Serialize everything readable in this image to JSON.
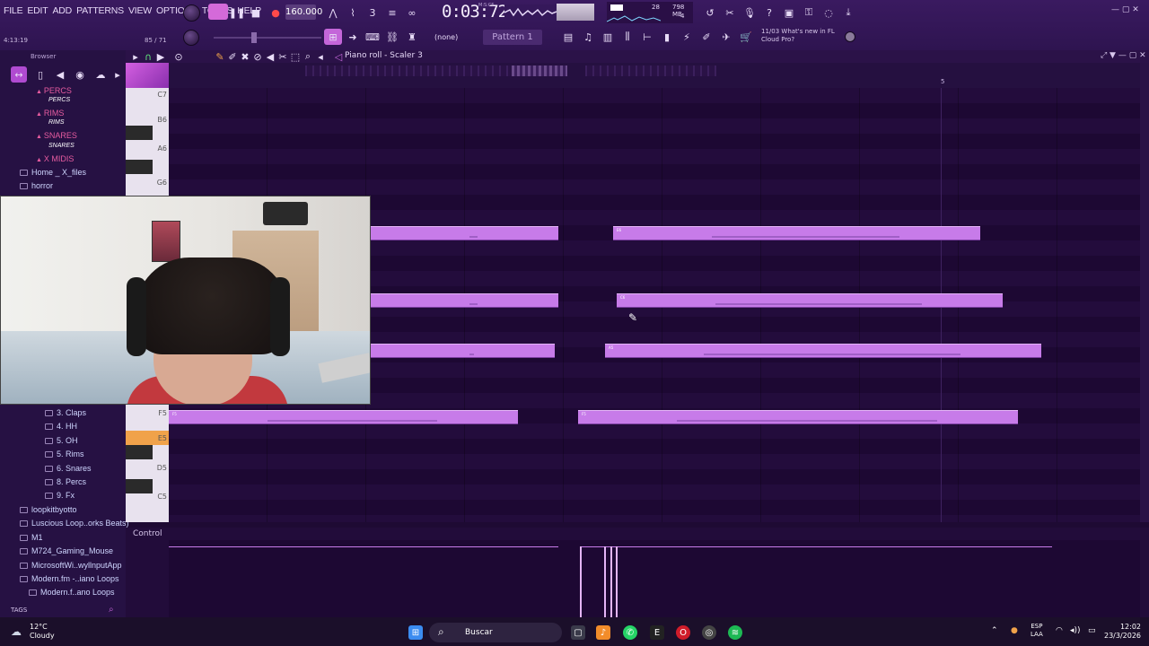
{
  "menu": [
    "FILE",
    "EDIT",
    "ADD",
    "PATTERNS",
    "VIEW",
    "OPTIONS",
    "TOOLS",
    "HELP"
  ],
  "transport": {
    "tempo": "160.000",
    "time": "0:03:72",
    "time_unit": "M:S:CS",
    "mem_value": "28",
    "mem_label": "798 MB",
    "mem_cores": "4"
  },
  "hint": {
    "position": "4:13:19",
    "counter": "85 / 71"
  },
  "pattern": {
    "selector": "(none)",
    "name": "Pattern 1"
  },
  "news": {
    "line1": "11/03  What's new in FL",
    "line2": "Cloud Pro?"
  },
  "browser": {
    "title": "Browser",
    "tags_label": "TAGS",
    "items": [
      {
        "label": "PERCS",
        "kind": "pink"
      },
      {
        "label": "PERCS",
        "kind": "sub"
      },
      {
        "label": "RIMS",
        "kind": "pink"
      },
      {
        "label": "RIMS",
        "kind": "sub"
      },
      {
        "label": "SNARES",
        "kind": "pink"
      },
      {
        "label": "SNARES",
        "kind": "sub"
      },
      {
        "label": "X MIDIS",
        "kind": "pink"
      },
      {
        "label": "Home _ X_files",
        "kind": "folder"
      },
      {
        "label": "horror",
        "kind": "folder"
      },
      {
        "label": "3. Claps",
        "kind": "sub2"
      },
      {
        "label": "4. HH",
        "kind": "sub2"
      },
      {
        "label": "5. OH",
        "kind": "sub2"
      },
      {
        "label": "5. Rims",
        "kind": "sub2"
      },
      {
        "label": "6. Snares",
        "kind": "sub2"
      },
      {
        "label": "8. Percs",
        "kind": "sub2"
      },
      {
        "label": "9. Fx",
        "kind": "sub2"
      },
      {
        "label": "loopkitbyotto",
        "kind": "folder"
      },
      {
        "label": "Luscious Loop..orks Beats)",
        "kind": "folder"
      },
      {
        "label": "M1",
        "kind": "folder"
      },
      {
        "label": "M724_Gaming_Mouse",
        "kind": "folder"
      },
      {
        "label": "MicrosoftWi..wyllnputApp",
        "kind": "folder"
      },
      {
        "label": "Modern.fm -..iano Loops",
        "kind": "folder"
      },
      {
        "label": "Modern.f..ano Loops",
        "kind": "folder2"
      }
    ]
  },
  "piano_roll": {
    "title": "Piano roll - Scaler 3",
    "control_label": "Control",
    "ruler_bar": "5",
    "keys": [
      {
        "label": "C7"
      },
      {
        "label": "B6"
      },
      {
        "label": "A6"
      },
      {
        "label": "G6"
      },
      {
        "label": "F5"
      },
      {
        "label": "E5"
      },
      {
        "label": "D5"
      },
      {
        "label": "C5"
      }
    ],
    "notes": [
      {
        "label": "",
        "start": 0,
        "end": 1.01
      },
      {
        "label": "E6",
        "start": 1.15,
        "end": 2.1
      },
      {
        "label": "",
        "start": 0,
        "end": 1.01
      },
      {
        "label": "C6",
        "start": 1.16,
        "end": 2.16
      },
      {
        "label": "",
        "start": 0,
        "end": 1.0
      },
      {
        "label": "A5",
        "start": 1.13,
        "end": 2.26
      },
      {
        "label": "F5",
        "start": 0,
        "end": 0.9
      },
      {
        "label": "F5",
        "start": 1.06,
        "end": 2.2
      }
    ]
  },
  "taskbar": {
    "temp": "12°C",
    "weather": "Cloudy",
    "search": "Buscar",
    "lang1": "ESP",
    "lang2": "LAA",
    "time": "12:02",
    "date": "23/3/2026"
  },
  "colors": {
    "note": "#c77be9",
    "accent": "#f0a24a",
    "bg": "#1f0a36"
  }
}
